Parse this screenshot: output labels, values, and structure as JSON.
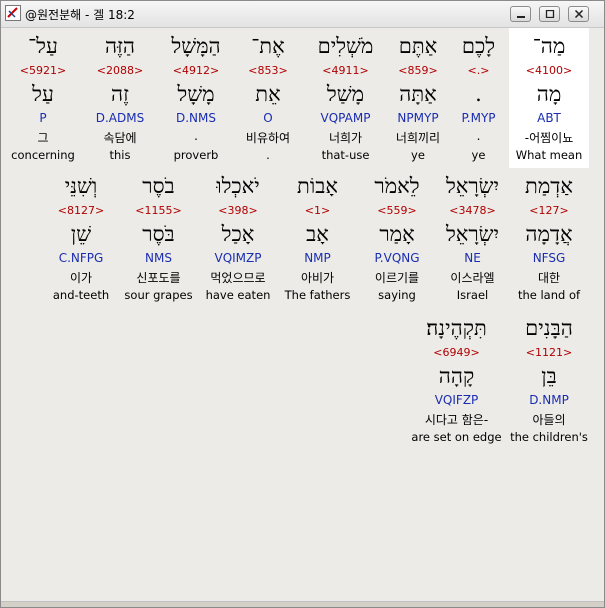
{
  "window": {
    "title": "@원전분해 - 겔 18:2"
  },
  "rows": [
    [
      {
        "heb": "עַל־",
        "strong": "<5921>",
        "lemma": "עַל",
        "parse": "P",
        "kor": "그",
        "eng": "concerning"
      },
      {
        "heb": "הַזֶּה",
        "strong": "<2088>",
        "lemma": "זֶה",
        "parse": "D.ADMS",
        "kor": "속담에",
        "eng": "this"
      },
      {
        "heb": "הַמָּשָׁל",
        "strong": "<4912>",
        "lemma": "מָשָׁל",
        "parse": "D.NMS",
        "kor": ".",
        "eng": "proverb"
      },
      {
        "heb": "אֶת־",
        "strong": "<853>",
        "lemma": "אֵת",
        "parse": "O",
        "kor": "비유하여",
        "eng": "."
      },
      {
        "heb": "מֹשְׁלִים",
        "strong": "<4911>",
        "lemma": "מָשַׁל",
        "parse": "VQPAMP",
        "kor": "너희가",
        "eng": "that-use"
      },
      {
        "heb": "אַתֶּם",
        "strong": "<859>",
        "lemma": "אַתָּה",
        "parse": "NPMYP",
        "kor": "너희끼리",
        "eng": "ye"
      },
      {
        "heb": "לָכֶם",
        "strong": "<.>",
        "lemma": ".",
        "parse": "P.MYP",
        "kor": ".",
        "eng": "ye"
      },
      {
        "heb": "מַה־",
        "strong": "<4100>",
        "lemma": "מָה",
        "parse": "ABT",
        "kor": "-어찜이뇨",
        "eng": "What mean"
      }
    ],
    [
      {
        "heb": "וְשִׁנֵּי",
        "strong": "<8127>",
        "lemma": "שֵׁן",
        "parse": "C.NFPG",
        "kor": "이가",
        "eng": "and-teeth"
      },
      {
        "heb": "בֹסֶר",
        "strong": "<1155>",
        "lemma": "בֹּסֶר",
        "parse": "NMS",
        "kor": "신포도를",
        "eng": "sour grapes"
      },
      {
        "heb": "יֹאכְלוּ",
        "strong": "<398>",
        "lemma": "אָכַל",
        "parse": "VQIMZP",
        "kor": "먹었으므로",
        "eng": "have eaten"
      },
      {
        "heb": "אָבוֹת",
        "strong": "<1>",
        "lemma": "אָב",
        "parse": "NMP",
        "kor": "아비가",
        "eng": "The fathers"
      },
      {
        "heb": "לֵאמֹר",
        "strong": "<559>",
        "lemma": "אָמַר",
        "parse": "P.VQNG",
        "kor": "이르기를",
        "eng": "saying"
      },
      {
        "heb": "יִשְׂרָאֵל",
        "strong": "<3478>",
        "lemma": "יִשְׂרָאֵל",
        "parse": "NE",
        "kor": "이스라엘",
        "eng": "Israel"
      },
      {
        "heb": "אַדְמַת",
        "strong": "<127>",
        "lemma": "אֲדָמָה",
        "parse": "NFSG",
        "kor": "대한",
        "eng": "the land of"
      }
    ],
    [
      {
        "heb": "תִּקְהֶינָה׃",
        "strong": "<6949>",
        "lemma": "קָהָה",
        "parse": "VQIFZP",
        "kor": "시다고 함은-",
        "eng": "are set on edge"
      },
      {
        "heb": "הַבָּנִים",
        "strong": "<1121>",
        "lemma": "בֵּן",
        "parse": "D.NMP",
        "kor": "아들의",
        "eng": "the children's"
      }
    ]
  ]
}
